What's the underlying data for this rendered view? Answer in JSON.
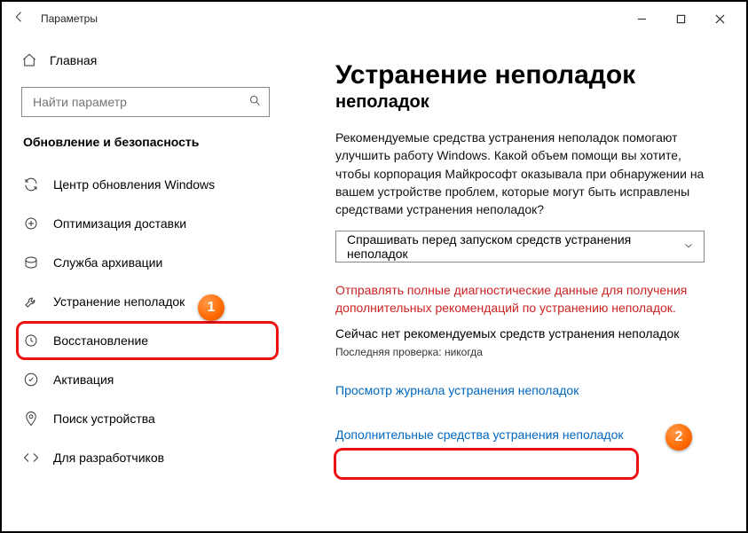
{
  "window": {
    "title": "Параметры"
  },
  "sidebar": {
    "home": "Главная",
    "search_placeholder": "Найти параметр",
    "section": "Обновление и безопасность",
    "items": [
      {
        "label": "Центр обновления Windows"
      },
      {
        "label": "Оптимизация доставки"
      },
      {
        "label": "Служба архивации"
      },
      {
        "label": "Устранение неполадок"
      },
      {
        "label": "Восстановление"
      },
      {
        "label": "Активация"
      },
      {
        "label": "Поиск устройства"
      },
      {
        "label": "Для разработчиков"
      }
    ]
  },
  "main": {
    "heading": "Устранение неполадок",
    "subheading": "неполадок",
    "description": "Рекомендуемые средства устранения неполадок помогают улучшить работу Windows. Какой объем помощи вы хотите, чтобы корпорация Майкрософт оказывала при обнаружении на вашем устройстве проблем, которые могут быть исправлены средствами устранения неполадок?",
    "dropdown_value": "Спрашивать перед запуском средств устранения неполадок",
    "diag_text": "Отправлять полные диагностические данные для получения дополнительных рекомендаций по устранению неполадок.",
    "no_recommend": "Сейчас нет рекомендуемых средств устранения неполадок",
    "last_check": "Последняя проверка: никогда",
    "history_link": "Просмотр журнала устранения неполадок",
    "additional_link": "Дополнительные средства устранения неполадок"
  },
  "annotations": {
    "b1": "1",
    "b2": "2"
  }
}
